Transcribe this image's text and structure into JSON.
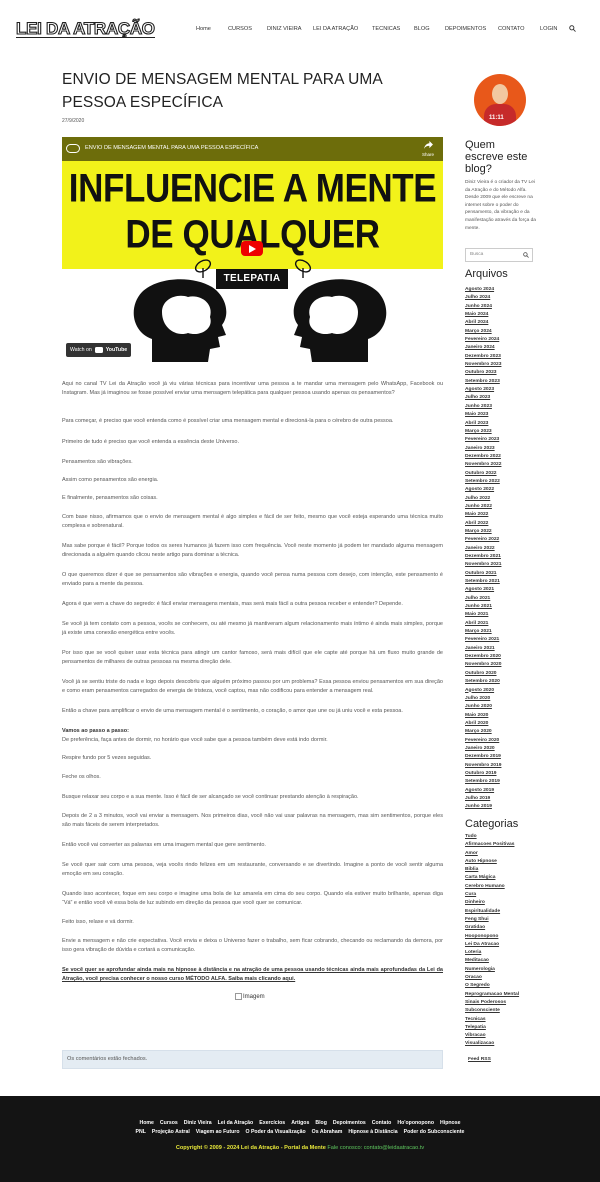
{
  "header": {
    "logo": "LEI DA ATRAÇÃO",
    "nav": [
      "Home",
      "CURSOS",
      "DINIZ VIEIRA",
      "LEI DA ATRAÇÃO",
      "TECNICAS",
      "BLOG",
      "DEPOIMENTOS",
      "CONTATO",
      "LOGIN"
    ]
  },
  "post": {
    "title": "ENVIO DE MENSAGEM MENTAL PARA UMA PESSOA ESPECÍFICA",
    "date": "27/9/2020",
    "video": {
      "top_title": "ENVIO DE MENSAGEM MENTAL PARA UMA PESSOA ESPECÍFICA",
      "share": "Share",
      "line1": "INFLUENCIE A MENTE",
      "line2": "DE QUALQUER PESSOA",
      "badge": "TELEPATIA",
      "watch_on": "Watch on",
      "youtube": "YouTube"
    },
    "paragraphs": [
      "Aqui no canal TV Lei da Atração você já viu várias técnicas para incentivar uma pessoa a te mandar uma mensagem pelo WhatsApp, Facebook ou Instagram. Mas já imaginou se fosse possível enviar uma mensagem telepática para qualquer pessoa usando apenas os pensamentos?",
      "Para começar, é preciso que você entenda como é possível criar uma mensagem mental e direcioná-la para o cérebro de outra pessoa.",
      "Primeiro de tudo é preciso que você entenda a essência deste Universo.",
      "Pensamentos são vibrações.",
      "Assim como pensamentos são energia.",
      "E finalmente, pensamentos são coisas.",
      "Com base nisso, afirmamos que o envio de mensagem mental é algo simples e fácil de ser feito, mesmo que você esteja esperando uma técnica muito complexa e sobrenatural.",
      "Mas sabe porque é fácil? Porque todos os seres humanos já fazem isso com frequência. Você neste momento já podem ter mandado alguma mensagem direcionada a alguém quando clicou neste artigo para dominar a técnica.",
      "O que queremos dizer é que se pensamentos são vibrações e energia, quando você pensa numa pessoa com desejo, com intenção, este pensamento é enviado para a mente da pessoa.",
      "Agora é que vem a chave do segredo: é fácil enviar mensagens mentais, mas será mais fácil a outra pessoa receber e entender? Depende.",
      "Se você já tem contato com a pessoa, vocês se conhecem, ou até mesmo já mantiveram algum relacionamento mais íntimo é ainda mais simples, porque já existe uma conexão energética entre vocês.",
      "Por isso que se você quiser usar esta técnica para atingir um cantor famoso, será mais difícil que ele capte até porque há um fluxo muito grande de pensamentos de milhares de outras pessoas na mesma direção dele.",
      "Você já se sentiu triste do nada e logo depois descobriu que alguém próximo passou por um problema? Essa pessoa enviou pensamentos em sua direção e como eram pensamentos carregados de energia de tristeza, você captou, mas não codificou para entender a mensagem real.",
      "Então a chave para amplificar o envio de uma mensagem mental é o sentimento, o coração, o amor que une ou já uniu você e esta pessoa.",
      "Vamos ao passo a passo:",
      "De preferência, faça antes de dormir, no horário que você sabe que a pessoa também deve está indo dormir.",
      "Respire fundo por 5 vezes seguidas.",
      "Feche os olhos.",
      "Busque relaxar seu corpo e a sua mente. Isso é fácil de ser alcançado se você continuar prestando atenção à respiração.",
      "Depois de 2 a 3 minutos, você vai enviar a mensagem. Nos primeiros dias, você não vai usar palavras na mensagem, mas sim sentimentos, porque eles são mais fáceis de serem interpretados.",
      "Então você vai converter as palavras em uma imagem mental que gere sentimento.",
      "Se você quer sair com uma pessoa, veja vocês rindo felizes em um restaurante, conversando e se divertindo. Imagine a ponto de você sentir alguma emoção em seu coração.",
      "Quando isso acontecer, foque em seu corpo e imagine uma bola de luz amarela em cima do seu corpo. Quando ela estiver muito brilhante, apenas diga “Vá” e então você vê essa bola de luz subindo em direção da pessoa que você quer se comunicar.",
      "Feito isso, relaxe e vá dormir.",
      "Envie a mensagem e não crie expectativa. Você envia e deixa o Universo fazer o trabalho, sem ficar cobrando, checando ou reclamando da demora, por isso gera vibração de dúvida e cortará a comunicação.",
      "Se você quer se aprofundar ainda mais na hipnose à distância e na atração de uma pessoa usando técnicas ainda mais aprofundadas da Lei da Atração, você precisa conhecer o nosso curso MÉTODO ALFA. Saiba mais clicando aqui."
    ],
    "image_alt": "Imagem",
    "comments_closed": "Os comentários estão fechados."
  },
  "sidebar": {
    "avatar_text": "11:11",
    "about_title": "Quem escreve este blog?",
    "about_text": "Diniz Vieira é o criador da TV Lei da Atração e do Método Alfa. Desde 2009 que ele escreve na internet sobre o poder do pensamento, da vibração e da manifestação através da força da mente.",
    "search_placeholder": "Busca",
    "archives_title": "Arquivos",
    "archives": [
      "Agosto 2024",
      "Julho 2024",
      "Junho 2024",
      "Maio 2024",
      "Abril 2024",
      "Março 2024",
      "Fevereiro 2024",
      "Janeiro 2024",
      "Dezembro 2023",
      "Novembro 2023",
      "Outubro 2023",
      "Setembro 2023",
      "Agosto 2023",
      "Julho 2023",
      "Junho 2023",
      "Maio 2023",
      "Abril 2023",
      "Março 2023",
      "Fevereiro 2023",
      "Janeiro 2023",
      "Dezembro 2022",
      "Novembro 2022",
      "Outubro 2022",
      "Setembro 2022",
      "Agosto 2022",
      "Julho 2022",
      "Junho 2022",
      "Maio 2022",
      "Abril 2022",
      "Março 2022",
      "Fevereiro 2022",
      "Janeiro 2022",
      "Dezembro 2021",
      "Novembro 2021",
      "Outubro 2021",
      "Setembro 2021",
      "Agosto 2021",
      "Julho 2021",
      "Junho 2021",
      "Maio 2021",
      "Abril 2021",
      "Março 2021",
      "Fevereiro 2021",
      "Janeiro 2021",
      "Dezembro 2020",
      "Novembro 2020",
      "Outubro 2020",
      "Setembro 2020",
      "Agosto 2020",
      "Julho 2020",
      "Junho 2020",
      "Maio 2020",
      "Abril 2020",
      "Março 2020",
      "Fevereiro 2020",
      "Janeiro 2020",
      "Dezembro 2019",
      "Novembro 2019",
      "Outubro 2019",
      "Setembro 2019",
      "Agosto 2019",
      "Julho 2019",
      "Junho 2019"
    ],
    "categories_title": "Categorias",
    "categories": [
      "Tudo",
      "Afirmacoes Positivas",
      "Amor",
      "Auto Hipnose",
      "Biblia",
      "Carta Mágica",
      "Cerebro Humano",
      "Cura",
      "Dinheiro",
      "Espiritualidade",
      "Feng Shui",
      "Gratidao",
      "Hooponopono",
      "Lei Da Atracao",
      "Loteria",
      "Meditacao",
      "Numerologia",
      "Oracao",
      "O Segredo",
      "Reprogramacao Mental",
      "Sinais Poderosos",
      "Subconsciente",
      "Tecnicas",
      "Telepatia",
      "Vibracao",
      "Visualizacao"
    ],
    "feed": "Feed RSS"
  },
  "footer": {
    "row1": [
      "Home",
      "Cursos",
      "Diniz Vieira",
      "Lei da Atração",
      "Exercícios",
      "Artigos",
      "Blog",
      "Depoimentos",
      "Contato",
      "Ho'oponopono",
      "Hipnose"
    ],
    "row2": [
      "PNL",
      "Projeção Astral",
      "Viagem ao Futuro",
      "O Poder da Visualização",
      "Os Abraham",
      "Hipnose à Distância",
      "Poder do Subconsciente"
    ],
    "copyright": "Copyright © 2009 - 2024 Lei da Atração - Portal da Mente",
    "contact": " Fale conosco: contato@leidaatracao.tv"
  }
}
